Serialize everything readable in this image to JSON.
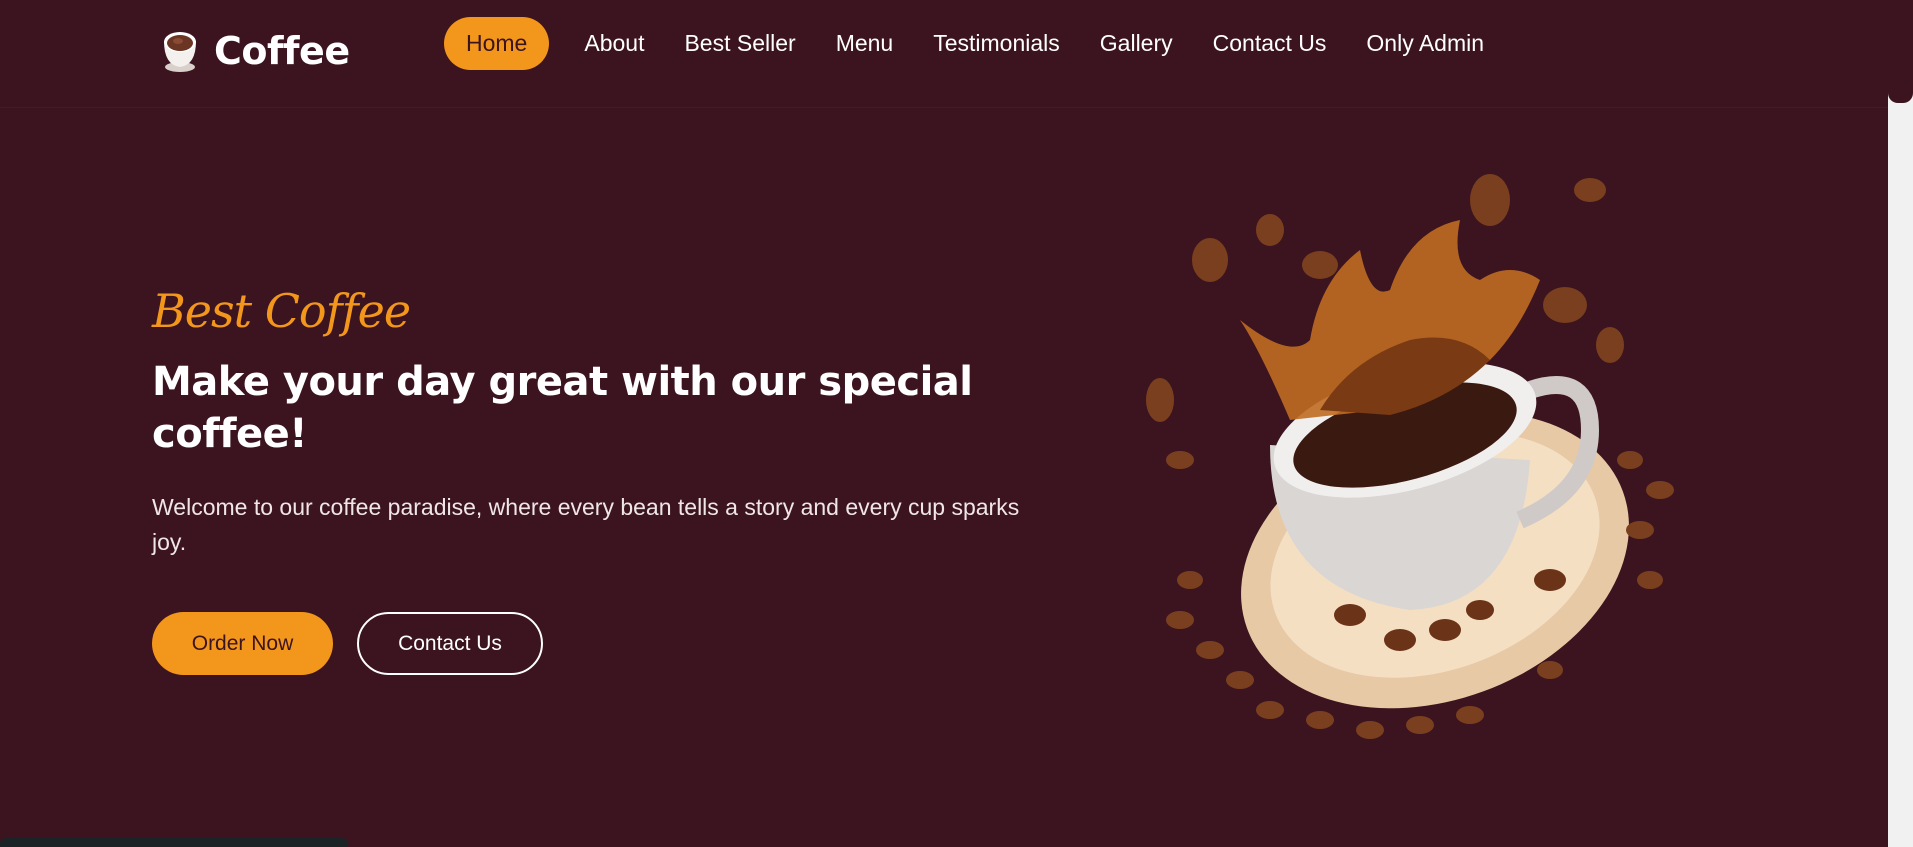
{
  "brand": {
    "name": "Coffee",
    "icon": "coffee-cup-icon"
  },
  "nav": {
    "items": [
      {
        "label": "Home",
        "active": true
      },
      {
        "label": "About",
        "active": false
      },
      {
        "label": "Best Seller",
        "active": false
      },
      {
        "label": "Menu",
        "active": false
      },
      {
        "label": "Testimonials",
        "active": false
      },
      {
        "label": "Gallery",
        "active": false
      },
      {
        "label": "Contact Us",
        "active": false
      },
      {
        "label": "Only Admin",
        "active": false
      }
    ]
  },
  "hero": {
    "subtitle": "Best Coffee",
    "title": "Make your day great with our special coffee!",
    "description": "Welcome to our coffee paradise, where every bean tells a story and every cup sparks joy.",
    "order_button": "Order Now",
    "contact_button": "Contact Us",
    "image": "coffee-splash-image"
  },
  "colors": {
    "background": "#3b141f",
    "accent": "#f3961c",
    "text": "#ffffff"
  }
}
